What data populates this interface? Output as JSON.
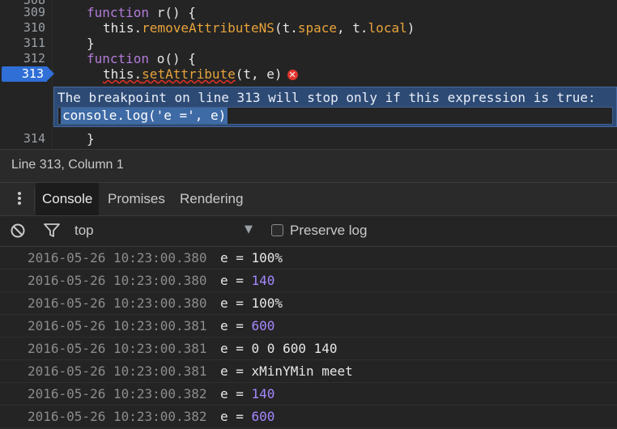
{
  "editor": {
    "line_numbers": {
      "l1": "309",
      "l2": "310",
      "l3": "311",
      "l4": "312",
      "l5": "313",
      "l6": "314"
    },
    "code": {
      "l309_kw": "function",
      "l309_rest": " r() {",
      "l310_this": "this.",
      "l310_fn": "removeAttributeNS",
      "l310_rest": "(t.",
      "l310_space": "space",
      "l310_mid": ", t.",
      "l310_local": "local",
      "l310_end": ")",
      "l311": "}",
      "l312_kw": "function",
      "l312_rest": " o() {",
      "l313_this": "this.",
      "l313_fn": "setAttribute",
      "l313_rest": "(t, e)",
      "l314": "}"
    },
    "error_icon": "close-icon",
    "breakpoint_message": "The breakpoint on line 313 will stop only if this expression is true:",
    "breakpoint_condition": "console.log('e =', e)"
  },
  "status_bar": {
    "position": "Line 313, Column 1"
  },
  "tabs": [
    {
      "label": "Console",
      "active": true
    },
    {
      "label": "Promises",
      "active": false
    },
    {
      "label": "Rendering",
      "active": false
    }
  ],
  "filter_bar": {
    "context": "top",
    "preserve_log_label": "Preserve log",
    "preserve_log_checked": false
  },
  "console_rows": [
    {
      "timestamp": "2016-05-26 10:23:00.380",
      "prefix": "e = ",
      "value": "100%",
      "numeric": false
    },
    {
      "timestamp": "2016-05-26 10:23:00.380",
      "prefix": "e = ",
      "value": "140",
      "numeric": true
    },
    {
      "timestamp": "2016-05-26 10:23:00.380",
      "prefix": "e = ",
      "value": "100%",
      "numeric": false
    },
    {
      "timestamp": "2016-05-26 10:23:00.381",
      "prefix": "e = ",
      "value": "600",
      "numeric": true
    },
    {
      "timestamp": "2016-05-26 10:23:00.381",
      "prefix": "e = ",
      "value": "0 0 600 140",
      "numeric": false
    },
    {
      "timestamp": "2016-05-26 10:23:00.381",
      "prefix": "e = ",
      "value": "xMinYMin meet",
      "numeric": false
    },
    {
      "timestamp": "2016-05-26 10:23:00.382",
      "prefix": "e = ",
      "value": "140",
      "numeric": true
    },
    {
      "timestamp": "2016-05-26 10:23:00.382",
      "prefix": "e = ",
      "value": "600",
      "numeric": true
    }
  ],
  "colors": {
    "breakpoint": "#2f6fd6",
    "keyword": "#b27bd9",
    "function": "#e8a33b",
    "number": "#a487ff",
    "error": "#e0372f"
  }
}
